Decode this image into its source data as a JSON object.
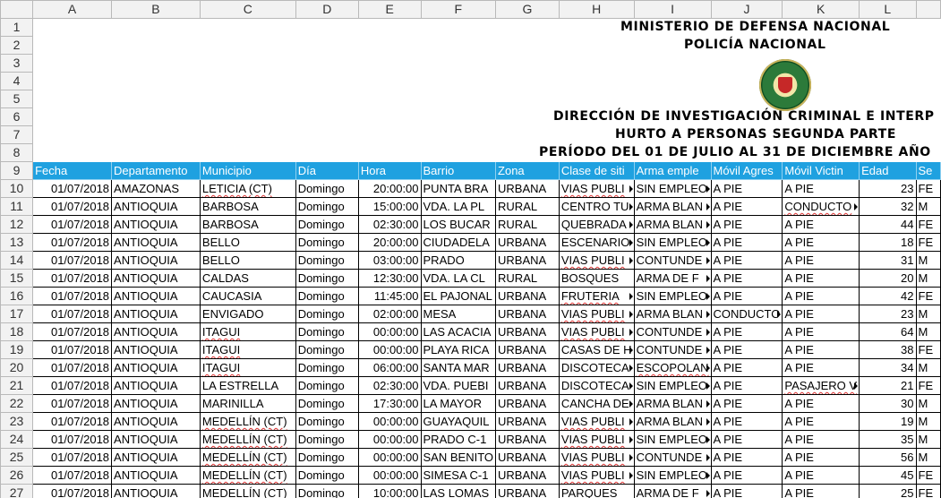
{
  "columns": [
    "A",
    "B",
    "C",
    "D",
    "E",
    "F",
    "G",
    "H",
    "I",
    "J",
    "K",
    "L"
  ],
  "rows_numbers": [
    "1",
    "2",
    "3",
    "4",
    "5",
    "6",
    "7",
    "8",
    "9",
    "10",
    "11",
    "12",
    "13",
    "14",
    "15",
    "16",
    "17",
    "18",
    "19",
    "20",
    "21",
    "22",
    "23",
    "24",
    "25",
    "26",
    "27"
  ],
  "titles": {
    "line1": "MINISTERIO DE DEFENSA NACIONAL",
    "line2": "POLICÍA NACIONAL",
    "line6": "DIRECCIÓN DE INVESTIGACIÓN CRIMINAL E INTERP",
    "line7": "HURTO A PERSONAS SEGUNDA PARTE",
    "line8": "PERÍODO DEL 01 DE JULIO  AL 31 DE DICIEMBRE AÑO"
  },
  "header": [
    "Fecha",
    "Departamento",
    "Municipio",
    "Día",
    "Hora",
    "Barrio",
    "Zona",
    "Clase de siti",
    "Arma emple",
    "Móvil Agres",
    "Móvil Victin",
    "Edad",
    "Se"
  ],
  "data_rows": [
    [
      "01/07/2018",
      "AMAZONAS",
      "LETICIA (CT)",
      "Domingo",
      "20:00:00",
      "PUNTA BRA",
      "URBANA",
      "VIAS PUBLI",
      "SIN EMPLEO",
      "A PIE",
      "A PIE",
      "23",
      "FE"
    ],
    [
      "01/07/2018",
      "ANTIOQUIA",
      "BARBOSA",
      "Domingo",
      "15:00:00",
      "VDA. LA PL",
      "RURAL",
      "CENTRO TU",
      "ARMA BLAN",
      "A PIE",
      "CONDUCTO",
      "32",
      "M"
    ],
    [
      "01/07/2018",
      "ANTIOQUIA",
      "BARBOSA",
      "Domingo",
      "02:30:00",
      "LOS BUCAR",
      "RURAL",
      "QUEBRADA",
      "ARMA BLAN",
      "A PIE",
      "A PIE",
      "44",
      "FE"
    ],
    [
      "01/07/2018",
      "ANTIOQUIA",
      "BELLO",
      "Domingo",
      "20:00:00",
      "CIUDADELA",
      "URBANA",
      "ESCENARIO",
      "SIN EMPLEO",
      "A PIE",
      "A PIE",
      "18",
      "FE"
    ],
    [
      "01/07/2018",
      "ANTIOQUIA",
      "BELLO",
      "Domingo",
      "03:00:00",
      "PRADO",
      "URBANA",
      "VIAS PUBLI",
      "CONTUNDE",
      "A PIE",
      "A PIE",
      "31",
      "M"
    ],
    [
      "01/07/2018",
      "ANTIOQUIA",
      "CALDAS",
      "Domingo",
      "12:30:00",
      "VDA. LA CL",
      "RURAL",
      "BOSQUES",
      "ARMA DE F",
      "A PIE",
      "A PIE",
      "20",
      "M"
    ],
    [
      "01/07/2018",
      "ANTIOQUIA",
      "CAUCASIA",
      "Domingo",
      "11:45:00",
      "EL PAJONAL",
      "URBANA",
      "FRUTERIA",
      "SIN EMPLEO",
      "A PIE",
      "A PIE",
      "42",
      "FE"
    ],
    [
      "01/07/2018",
      "ANTIOQUIA",
      "ENVIGADO",
      "Domingo",
      "02:00:00",
      "MESA",
      "URBANA",
      "VIAS PUBLI",
      "ARMA BLAN",
      "CONDUCTO",
      "A PIE",
      "23",
      "M"
    ],
    [
      "01/07/2018",
      "ANTIOQUIA",
      "ITAGUI",
      "Domingo",
      "00:00:00",
      "LAS ACACIA",
      "URBANA",
      "VIAS PUBLI",
      "CONTUNDE",
      "A PIE",
      "A PIE",
      "64",
      "M"
    ],
    [
      "01/07/2018",
      "ANTIOQUIA",
      "ITAGUI",
      "Domingo",
      "00:00:00",
      "PLAYA RICA",
      "URBANA",
      "CASAS DE H",
      "CONTUNDE",
      "A PIE",
      "A PIE",
      "38",
      "FE"
    ],
    [
      "01/07/2018",
      "ANTIOQUIA",
      "ITAGUI",
      "Domingo",
      "06:00:00",
      "SANTA MAR",
      "URBANA",
      "DISCOTECA",
      "ESCOPOLAN",
      "A PIE",
      "A PIE",
      "34",
      "M"
    ],
    [
      "01/07/2018",
      "ANTIOQUIA",
      "LA ESTRELLA",
      "Domingo",
      "02:30:00",
      "VDA. PUEBI",
      "URBANA",
      "DISCOTECA",
      "SIN EMPLEO",
      "A PIE",
      "PASAJERO V",
      "21",
      "FE"
    ],
    [
      "01/07/2018",
      "ANTIOQUIA",
      "MARINILLA",
      "Domingo",
      "17:30:00",
      "LA MAYOR",
      "URBANA",
      "CANCHA DE",
      "ARMA BLAN",
      "A PIE",
      "A PIE",
      "30",
      "M"
    ],
    [
      "01/07/2018",
      "ANTIOQUIA",
      "MEDELLÍN (CT)",
      "Domingo",
      "00:00:00",
      "GUAYAQUIL",
      "URBANA",
      "VIAS PUBLI",
      "ARMA BLAN",
      "A PIE",
      "A PIE",
      "19",
      "M"
    ],
    [
      "01/07/2018",
      "ANTIOQUIA",
      "MEDELLÍN (CT)",
      "Domingo",
      "00:00:00",
      "PRADO C-1",
      "URBANA",
      "VIAS PUBLI",
      "SIN EMPLEO",
      "A PIE",
      "A PIE",
      "35",
      "M"
    ],
    [
      "01/07/2018",
      "ANTIOQUIA",
      "MEDELLÍN (CT)",
      "Domingo",
      "00:00:00",
      "SAN BENITO",
      "URBANA",
      "VIAS PUBLI",
      "CONTUNDE",
      "A PIE",
      "A PIE",
      "56",
      "M"
    ],
    [
      "01/07/2018",
      "ANTIOQUIA",
      "MEDELLÍN (CT)",
      "Domingo",
      "00:00:00",
      "SIMESA C-1",
      "URBANA",
      "VIAS PUBLI",
      "SIN EMPLEO",
      "A PIE",
      "A PIE",
      "45",
      "FE"
    ],
    [
      "01/07/2018",
      "ANTIOQUIA",
      "MEDELLÍN (CT)",
      "Domingo",
      "10:00:00",
      "LAS LOMAS",
      "URBANA",
      "PARQUES",
      "ARMA DE F",
      "A PIE",
      "A PIE",
      "25",
      "FE"
    ]
  ],
  "colors": {
    "header_bg": "#1fa1e0",
    "header_fg": "#ffffff",
    "spellcheck": "#d33"
  }
}
